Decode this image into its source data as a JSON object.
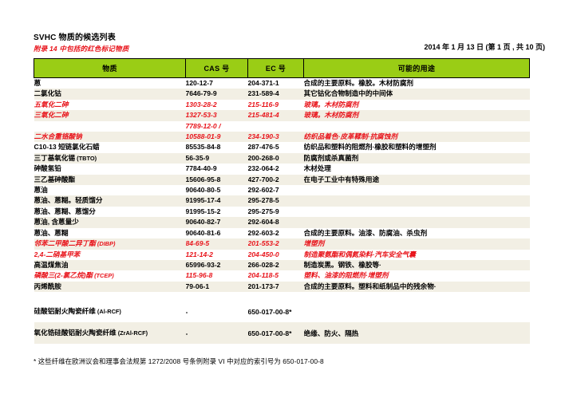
{
  "document": {
    "title": "SVHC 物质的候选列表",
    "subtitle_prefix": "附录 14 中包括的",
    "subtitle_red": "红色标记物质",
    "subtitle_full": "附录 14 中包括的红色标记物质",
    "date_line": "2014 年 1 月 13 日 (第 1 页 , 共 10 页)"
  },
  "colors": {
    "header_green": "#9acd15",
    "red_text": "#e8131a",
    "stripe": "#f2efe4",
    "border": "#000000"
  },
  "table": {
    "columns": [
      {
        "key": "substance",
        "label": "物质"
      },
      {
        "key": "cas",
        "label": "CAS 号"
      },
      {
        "key": "ec",
        "label": "EC 号"
      },
      {
        "key": "use",
        "label": "可能的用途"
      }
    ],
    "rows": [
      {
        "substance": "蒽",
        "note": "",
        "cas": "120-12-7",
        "ec": "204-371-1",
        "use": "合成的主要原料。橡胶。木材防腐剂",
        "red": false,
        "stripe": false
      },
      {
        "substance": "二氯化钴",
        "note": "",
        "cas": "7646-79-9",
        "ec": "231-589-4",
        "use": "其它钴化合物制造中的中间体",
        "red": false,
        "stripe": true
      },
      {
        "substance": "五氧化二砷",
        "note": "",
        "cas": "1303-28-2",
        "ec": "215-116-9",
        "use": "玻璃。木材防腐剂",
        "red": true,
        "stripe": false
      },
      {
        "substance": "三氧化二砷",
        "note": "",
        "cas": "1327-53-3",
        "ec": "215-481-4",
        "use": "玻璃。木材防腐剂",
        "red": true,
        "stripe": true
      },
      {
        "substance": "",
        "note": "",
        "cas": "7789-12-0 /",
        "ec": "",
        "use": "",
        "red": true,
        "stripe": false
      },
      {
        "substance": "二水合重铬酸钠",
        "note": "",
        "cas": "10588-01-9",
        "ec": "234-190-3",
        "use": "纺织品着色·皮革鞣制·抗腐蚀剂",
        "red": true,
        "stripe": true
      },
      {
        "substance": "C10-13 短链氯化石蜡",
        "note": "",
        "cas": "85535-84-8",
        "ec": "287-476-5",
        "use": "纺织品和塑料的阻燃剂·橡胶和塑料的增塑剂",
        "red": false,
        "stripe": false
      },
      {
        "substance": "三丁基氧化锡",
        "note": "(TBTO)",
        "cas": "56-35-9",
        "ec": "200-268-0",
        "use": "防腐剂或杀真菌剂",
        "red": false,
        "stripe": true
      },
      {
        "substance": "砷酸氢铅",
        "note": "",
        "cas": "7784-40-9",
        "ec": "232-064-2",
        "use": "木材处理",
        "red": false,
        "stripe": false
      },
      {
        "substance": "三乙基砷酸酯",
        "note": "",
        "cas": "15606-95-8",
        "ec": "427-700-2",
        "use": "在电子工业中有特殊用途",
        "red": false,
        "stripe": true
      },
      {
        "substance": "蒽油",
        "note": "",
        "cas": "90640-80-5",
        "ec": "292-602-7",
        "use": "",
        "red": false,
        "stripe": false
      },
      {
        "substance": "蒽油、蒽糊。轻质馏分",
        "note": "",
        "cas": "91995-17-4",
        "ec": "295-278-5",
        "use": "",
        "red": false,
        "stripe": true
      },
      {
        "substance": "蒽油、蒽糊、蒽馏分",
        "note": "",
        "cas": "91995-15-2",
        "ec": "295-275-9",
        "use": "",
        "red": false,
        "stripe": false
      },
      {
        "substance": "蒽油, 含蒽量少",
        "note": "",
        "cas": "90640-82-7",
        "ec": "292-604-8",
        "use": "",
        "red": false,
        "stripe": true
      },
      {
        "substance": "蒽油、蒽糊",
        "note": "",
        "cas": "90640-81-6",
        "ec": "292-603-2",
        "use": "合成的主要原料。油漆、防腐油、杀虫剂",
        "red": false,
        "stripe": false
      },
      {
        "substance": "邻苯二甲酸二异丁酯",
        "note": "(DIBP)",
        "cas": "84-69-5",
        "ec": "201-553-2",
        "use": "增塑剂",
        "red": true,
        "stripe": true
      },
      {
        "substance": "2,4-二硝基甲苯",
        "note": "",
        "cas": "121-14-2",
        "ec": "204-450-0",
        "use": "制造聚氨酯和偶氮染料·汽车安全气囊",
        "red": true,
        "stripe": false
      },
      {
        "substance": "高温煤焦油",
        "note": "",
        "cas": "65996-93-2",
        "ec": "266-028-2",
        "use": "制造炭黑。钢铁、橡胶等·",
        "red": false,
        "stripe": true
      },
      {
        "substance": "磷酸三(2-氯乙烷)酯",
        "note": "(TCEP)",
        "cas": "115-96-8",
        "ec": "204-118-5",
        "use": "塑料、油漆的阻燃剂·增塑剂",
        "red": true,
        "stripe": false
      },
      {
        "substance": "丙烯酰胺",
        "note": "",
        "cas": "79-06-1",
        "ec": "201-173-7",
        "use": "合成的主要原料。塑料和纸制品中的残余物·",
        "red": false,
        "stripe": true
      },
      {
        "substance": "硅酸铝耐火陶瓷纤维",
        "note": "(Al-RCF)",
        "cas": "-",
        "ec": "650-017-00-8*",
        "use": "",
        "red": false,
        "stripe": false
      },
      {
        "substance": "氧化锆硅酸铝耐火陶瓷纤维",
        "note": "(ZrAl-RCF)",
        "cas": "-",
        "ec": "650-017-00-8*",
        "use": "绝缘、防火、隔热",
        "red": false,
        "stripe": true
      }
    ]
  },
  "footnote": {
    "text": "* 这些纤维在欧洲议会和理事会法规第 1272/2008 号条例附录 VI 中对应的索引号为 650-017-00-8"
  }
}
